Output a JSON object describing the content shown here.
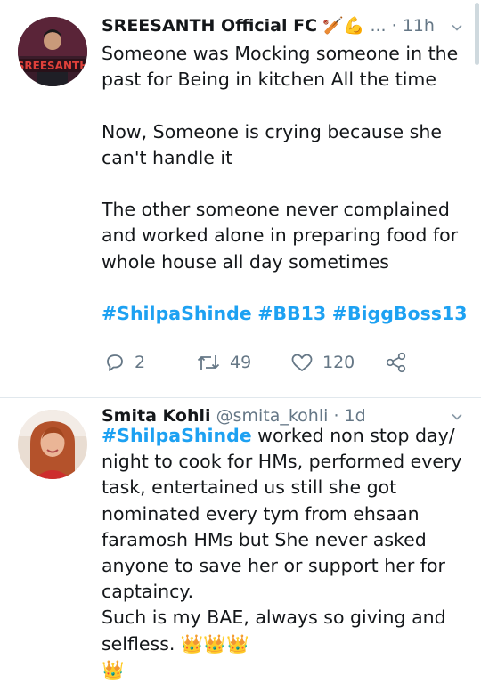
{
  "tweets": [
    {
      "author": "SREESANTH Official FC",
      "author_badges": "🏏💪",
      "ellipsis": "...",
      "time": "· 11h",
      "avatar_text": "SREESANTH",
      "lines": [
        "Someone was Mocking someone in the",
        "past for Being in kitchen All the time",
        "",
        "Now, Someone is crying because she",
        "can't handle it",
        "",
        "The other someone never complained",
        "and worked alone in preparing food for",
        "whole house all day sometimes",
        ""
      ],
      "hashtags": [
        "#ShilpaShinde",
        "#BB13",
        "#BiggBoss13"
      ],
      "replies": "2",
      "retweets": "49",
      "likes": "120"
    },
    {
      "author": "Smita Kohli",
      "handle": "@smita_kohli",
      "time": "· 1d",
      "first_hashtag": "#ShilpaShinde",
      "first_line_rest": " worked non stop day/",
      "lines": [
        "night to cook for HMs, performed every",
        "task, entertained us still she got",
        "nominated every tym from ehsaan",
        "faramosh HMs but She never asked",
        "anyone to save her or support her for",
        "captaincy.",
        "Such is my BAE, always so giving and",
        "selfless. 👑👑👑",
        "👑"
      ]
    }
  ],
  "colors": {
    "link": "#1da1f2",
    "meta": "#657786",
    "text": "#14171a",
    "divider": "#e1e8ed"
  }
}
